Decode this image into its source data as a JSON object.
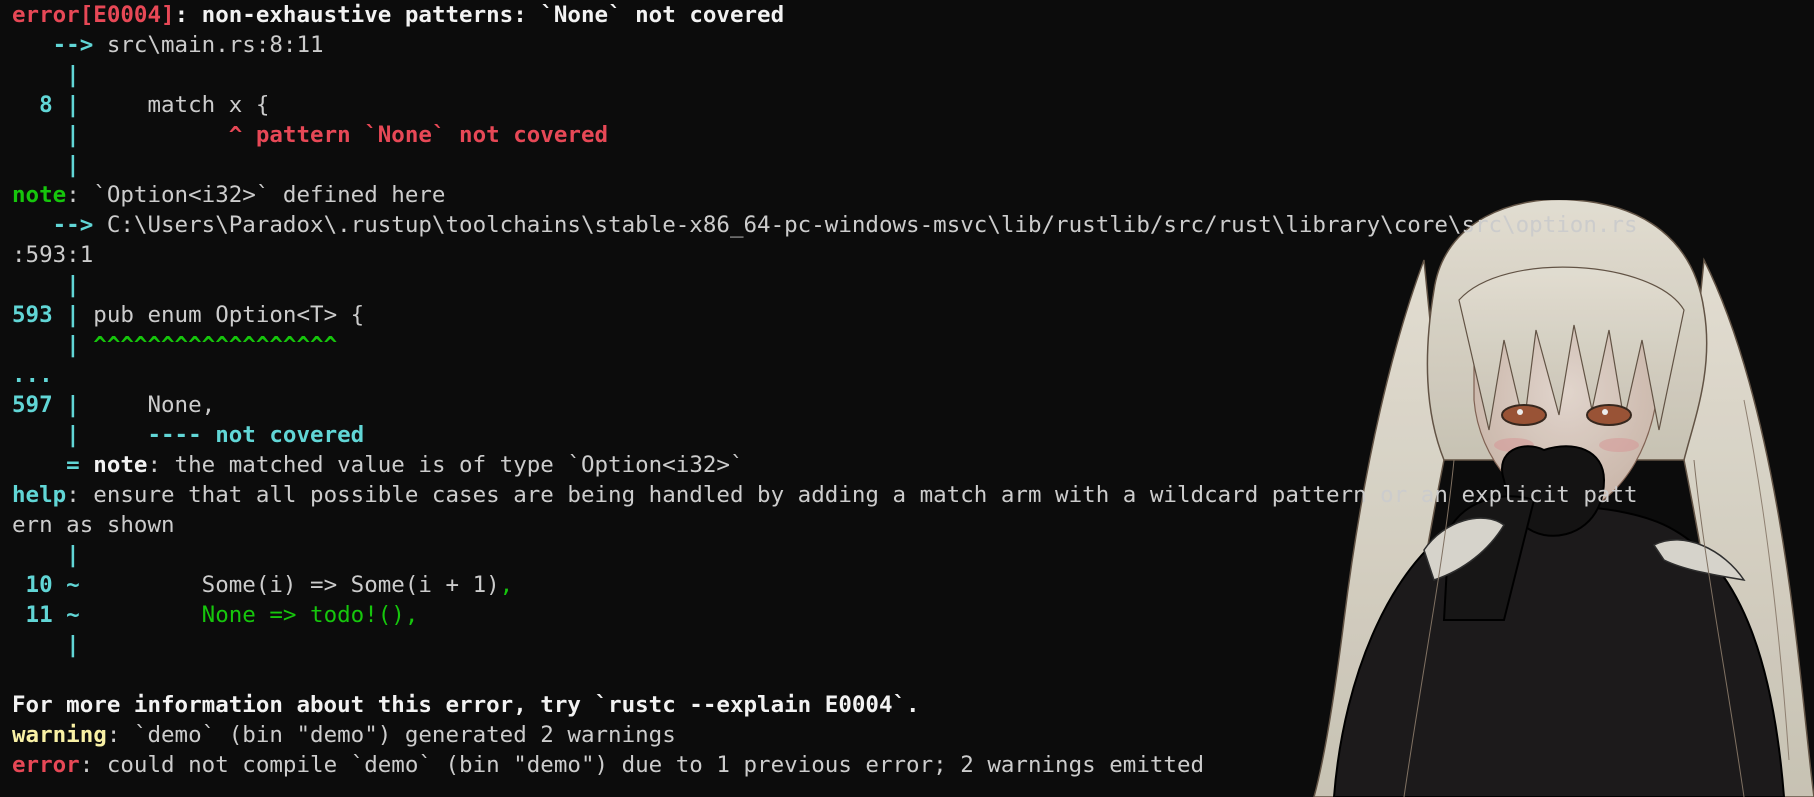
{
  "terminal": {
    "colors": {
      "background": "#0c0c0c",
      "foreground": "#cccccc",
      "error": "#e74856",
      "gutter": "#61d6d6",
      "suggestion": "#16c60c",
      "warning": "#f9f1a5",
      "emphasis": "#f2f2f2"
    },
    "lines": [
      [
        {
          "t": "error[E0004]",
          "c": "red bold"
        },
        {
          "t": ": non-exhaustive patterns: `None` not covered",
          "c": "white bold"
        }
      ],
      [
        {
          "t": "   --> ",
          "c": "cyan bold"
        },
        {
          "t": "src\\main.rs:8:11",
          "c": ""
        }
      ],
      [
        {
          "t": "    |",
          "c": "cyan bold"
        }
      ],
      [
        {
          "t": "  8 |",
          "c": "cyan bold"
        },
        {
          "t": "     match x {",
          "c": ""
        }
      ],
      [
        {
          "t": "    |",
          "c": "cyan bold"
        },
        {
          "t": "           ^ pattern `None` not covered",
          "c": "red bold"
        }
      ],
      [
        {
          "t": "    |",
          "c": "cyan bold"
        }
      ],
      [
        {
          "t": "note",
          "c": "green bold"
        },
        {
          "t": ": `Option<i32>` defined here",
          "c": ""
        }
      ],
      [
        {
          "t": "   --> ",
          "c": "cyan bold"
        },
        {
          "t": "C:\\Users\\Paradox\\.rustup\\toolchains\\stable-x86_64-pc-windows-msvc\\lib/rustlib/src/rust\\library\\core\\src\\option.rs",
          "c": ""
        }
      ],
      [
        {
          "t": ":593:1",
          "c": ""
        }
      ],
      [
        {
          "t": "    |",
          "c": "cyan bold"
        }
      ],
      [
        {
          "t": "593 |",
          "c": "cyan bold"
        },
        {
          "t": " pub enum Option<T> {",
          "c": ""
        }
      ],
      [
        {
          "t": "    |",
          "c": "cyan bold"
        },
        {
          "t": " ^^^^^^^^^^^^^^^^^^",
          "c": "green bold"
        }
      ],
      [
        {
          "t": "...",
          "c": "cyan bold"
        }
      ],
      [
        {
          "t": "597 |",
          "c": "cyan bold"
        },
        {
          "t": "     None,",
          "c": ""
        }
      ],
      [
        {
          "t": "    |",
          "c": "cyan bold"
        },
        {
          "t": "     ---- not covered",
          "c": "cyan bold"
        }
      ],
      [
        {
          "t": "    = ",
          "c": "cyan bold"
        },
        {
          "t": "note",
          "c": "white bold"
        },
        {
          "t": ": the matched value is of type `Option<i32>`",
          "c": ""
        }
      ],
      [
        {
          "t": "help",
          "c": "cyan bold"
        },
        {
          "t": ": ensure that all possible cases are being handled by adding a match arm with a wildcard pattern or an explicit patt",
          "c": ""
        }
      ],
      [
        {
          "t": "ern as shown",
          "c": ""
        }
      ],
      [
        {
          "t": "    |",
          "c": "cyan bold"
        }
      ],
      [
        {
          "t": " 10 ~",
          "c": "cyan bold"
        },
        {
          "t": "         Some(i) => Some(i + 1)",
          "c": ""
        },
        {
          "t": ",",
          "c": "green"
        }
      ],
      [
        {
          "t": " 11 ~",
          "c": "cyan bold"
        },
        {
          "t": "         None => todo!(),",
          "c": "green"
        }
      ],
      [
        {
          "t": "    |",
          "c": "cyan bold"
        }
      ],
      [],
      [
        {
          "t": "For more information about this error, try `rustc --explain E0004`.",
          "c": "white bold"
        }
      ],
      [
        {
          "t": "warning",
          "c": "yellow bold"
        },
        {
          "t": ": `demo` (bin \"demo\") generated 2 warnings",
          "c": ""
        }
      ],
      [
        {
          "t": "error",
          "c": "red bold"
        },
        {
          "t": ": could not compile `demo` (bin \"demo\") due to 1 previous error; 2 warnings emitted",
          "c": ""
        }
      ]
    ]
  }
}
